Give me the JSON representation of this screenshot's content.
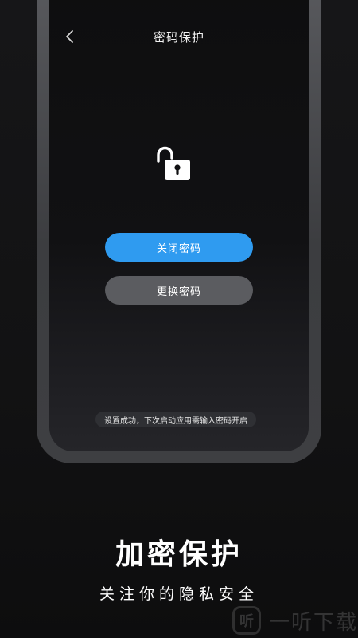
{
  "header": {
    "back_icon": "chevron-left-icon",
    "title": "密码保护"
  },
  "lock": {
    "icon": "unlocked-padlock-icon",
    "color": "#ffffff"
  },
  "actions": {
    "disable_label": "关闭密码",
    "change_label": "更换密码",
    "primary_color": "#2f9bf0",
    "secondary_color": "#5b5c60"
  },
  "toast": {
    "text": "设置成功，下次启动应用需输入密码开启"
  },
  "promo": {
    "headline": "加密保护",
    "subline": "关注你的隐私安全"
  },
  "watermark": {
    "icon_glyph": "听",
    "text": "一听下载"
  }
}
